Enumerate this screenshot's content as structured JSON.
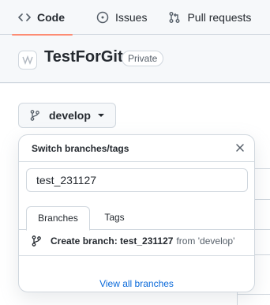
{
  "nav": {
    "tabs": [
      {
        "label": "Code",
        "icon": "code-icon",
        "selected": true
      },
      {
        "label": "Issues",
        "icon": "issue-opened-icon"
      },
      {
        "label": "Pull requests",
        "icon": "git-pull-request-icon"
      },
      {
        "label": "",
        "icon": "play-icon"
      }
    ],
    "accent": "#fd8c73"
  },
  "repo": {
    "name": "TestForGit",
    "visibility": "Private"
  },
  "branch_button": {
    "label": "develop",
    "icon": "git-branch-icon"
  },
  "branch_popover": {
    "title": "Switch branches/tags",
    "filter_value": "test_231127",
    "tabs": [
      {
        "label": "Branches",
        "selected": true
      },
      {
        "label": "Tags"
      }
    ],
    "create_row": {
      "icon": "git-branch-icon",
      "prefix": "Create branch: test_231127",
      "suffix": "from 'develop'"
    },
    "footer_link": "View all branches"
  }
}
